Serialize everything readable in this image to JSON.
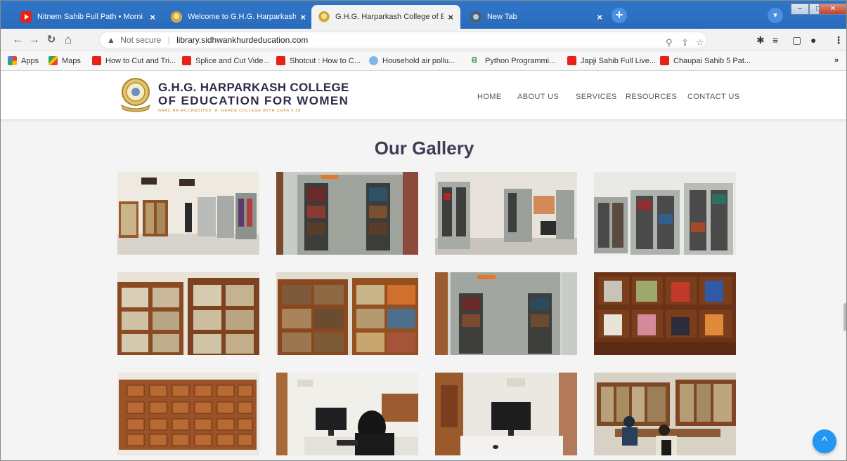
{
  "browser": {
    "tabs": [
      {
        "label": "Nitnem Sahib Full Path • Morni",
        "icon": "youtube-icon",
        "active": false
      },
      {
        "label": "Welcome to G.H.G. Harparkash C",
        "icon": "college-logo-icon",
        "active": false
      },
      {
        "label": "G.H.G. Harparkash College of Edu",
        "icon": "college-logo-icon",
        "active": true
      },
      {
        "label": "New Tab",
        "icon": "new-tab-icon",
        "active": false
      }
    ],
    "new_tab_label": "+",
    "omnibox": {
      "security_label": "Not secure",
      "url": "library.sidhwankhurdeducation.com"
    },
    "bookmarks": [
      {
        "label": "Apps",
        "icon": "apps-icon"
      },
      {
        "label": "Maps",
        "icon": "maps-icon"
      },
      {
        "label": "How to Cut and Tri...",
        "icon": "youtube-icon"
      },
      {
        "label": "Splice and Cut Vide...",
        "icon": "youtube-icon"
      },
      {
        "label": "Shotcut : How to C...",
        "icon": "youtube-icon"
      },
      {
        "label": "Household air pollu...",
        "icon": "who-icon"
      },
      {
        "label": "Python Programmi...",
        "icon": "gfg-icon"
      },
      {
        "label": "Japji Sahib Full Live...",
        "icon": "youtube-icon"
      },
      {
        "label": "Chaupai Sahib 5 Pat...",
        "icon": "youtube-icon"
      }
    ],
    "more_bookmarks": "»",
    "colors": {
      "tabstrip": "#2f76c8",
      "toolbar": "#f2f2f2"
    }
  },
  "site": {
    "college_name_line1": "G.H.G. HARPARKASH COLLEGE",
    "college_name_line2": "OF EDUCATION FOR WOMEN",
    "college_tagline": "NAAC RE-ACCREDITED 'A' GRADE COLLEGE WITH CGPA 3.28",
    "nav": [
      "HOME",
      "ABOUT US",
      "SERVICES",
      "RESOURCES",
      "CONTACT US"
    ],
    "gallery_title": "Our Gallery",
    "gallery_images": [
      {
        "name": "library-hall-photo",
        "scene": "library hall with bookshelves"
      },
      {
        "name": "steel-almirah-photo",
        "scene": "grey steel book almirah"
      },
      {
        "name": "almirahs-window-photo",
        "scene": "almirahs near windows"
      },
      {
        "name": "glass-almirahs-photo",
        "scene": "row of glass almirahs"
      },
      {
        "name": "wooden-shelves-photo",
        "scene": "wooden bookshelves"
      },
      {
        "name": "wooden-cabinets-photo",
        "scene": "wooden book cabinets"
      },
      {
        "name": "steel-cupboard-photo",
        "scene": "steel cupboard with books"
      },
      {
        "name": "journal-rack-photo",
        "scene": "journal display rack"
      },
      {
        "name": "card-catalogue-photo",
        "scene": "wooden card catalogue"
      },
      {
        "name": "student-computer-photo",
        "scene": "student at computer"
      },
      {
        "name": "computer-desk-photo",
        "scene": "computer on desk"
      },
      {
        "name": "reading-room-photo",
        "scene": "students in reading room"
      }
    ],
    "colors": {
      "title": "#3d3d55",
      "accent": "#2196f3",
      "page_bg": "#f4f4f4"
    }
  }
}
